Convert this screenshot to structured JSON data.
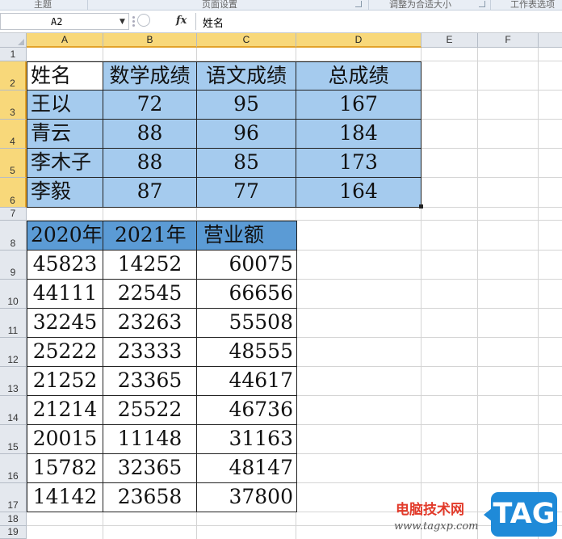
{
  "ribbon": {
    "groups": [
      "主题",
      "页面设置",
      "调整为合适大小",
      "工作表选项"
    ]
  },
  "formula_bar": {
    "name_box": "A2",
    "fx_label": "fx",
    "formula": "姓名"
  },
  "columns": [
    "A",
    "B",
    "C",
    "D",
    "E",
    "F"
  ],
  "rows": [
    "1",
    "2",
    "3",
    "4",
    "5",
    "6",
    "7",
    "8",
    "9",
    "10",
    "11",
    "12",
    "13",
    "14",
    "15",
    "16",
    "17",
    "18",
    "19"
  ],
  "table1": {
    "headers": [
      "姓名",
      "数学成绩",
      "语文成绩",
      "总成绩"
    ],
    "rows": [
      [
        "王以",
        "72",
        "95",
        "167"
      ],
      [
        "青云",
        "88",
        "96",
        "184"
      ],
      [
        "李木子",
        "88",
        "85",
        "173"
      ],
      [
        "李毅",
        "87",
        "77",
        "164"
      ]
    ]
  },
  "table2": {
    "headers": [
      "2020年",
      "2021年",
      "营业额"
    ],
    "rows": [
      [
        "45823",
        "14252",
        "60075"
      ],
      [
        "44111",
        "22545",
        "66656"
      ],
      [
        "32245",
        "23263",
        "55508"
      ],
      [
        "25222",
        "23333",
        "48555"
      ],
      [
        "21252",
        "23365",
        "44617"
      ],
      [
        "21214",
        "25522",
        "46736"
      ],
      [
        "20015",
        "11148",
        "31163"
      ],
      [
        "15782",
        "32365",
        "48147"
      ],
      [
        "14142",
        "23658",
        "37800"
      ]
    ]
  },
  "watermark": {
    "site_name": "电脑技术网",
    "url": "www.tagxp.com",
    "badge": "TAG"
  },
  "colors": {
    "table1_fill": "#a5cbee",
    "table2_header_fill": "#5b9bd5",
    "selected_header": "#f8d87a"
  }
}
